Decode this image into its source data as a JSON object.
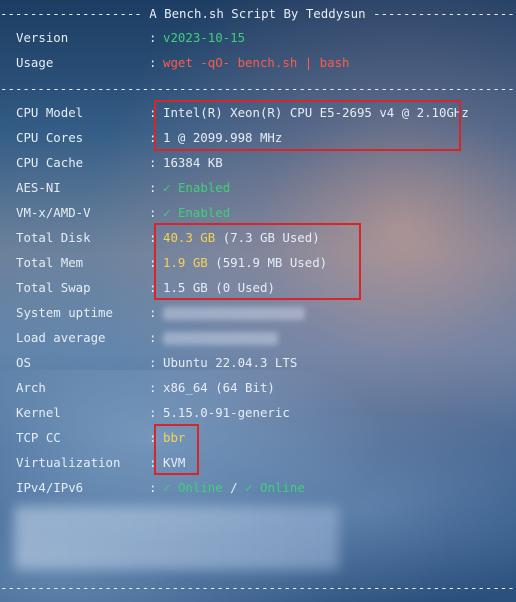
{
  "header_rule": "------------------- A Bench.sh Script By Teddysun -------------------",
  "footer_rule": "----------------------------------------------------------------------",
  "separator_rule": "----------------------------------------------------------------------",
  "colon": ":",
  "version": {
    "label": "Version",
    "value": "v2023-10-15"
  },
  "usage": {
    "label": "Usage",
    "value": "wget -qO- bench.sh | bash"
  },
  "cpu_model": {
    "label": "CPU Model",
    "value": "Intel(R) Xeon(R) CPU E5-2695 v4 @ 2.10GHz"
  },
  "cpu_cores": {
    "label": "CPU Cores",
    "value": "1 @ 2099.998 MHz"
  },
  "cpu_cache": {
    "label": "CPU Cache",
    "value": "16384 KB"
  },
  "aes_ni": {
    "label": "AES-NI",
    "check": "✓",
    "value": "Enabled"
  },
  "vmx": {
    "label": "VM-x/AMD-V",
    "check": "✓",
    "value": "Enabled"
  },
  "total_disk": {
    "label": "Total Disk",
    "value": "40.3 GB",
    "detail": "(7.3 GB Used)"
  },
  "total_mem": {
    "label": "Total Mem",
    "value": "1.9 GB",
    "detail": "(591.9 MB Used)"
  },
  "total_swap": {
    "label": "Total Swap",
    "value": "1.5 GB",
    "detail": "(0 Used)"
  },
  "uptime": {
    "label": "System uptime"
  },
  "load": {
    "label": "Load average"
  },
  "os": {
    "label": "OS",
    "value": "Ubuntu 22.04.3 LTS"
  },
  "arch": {
    "label": "Arch",
    "value": "x86_64 (64 Bit)"
  },
  "kernel": {
    "label": "Kernel",
    "value": "5.15.0-91-generic"
  },
  "tcp_cc": {
    "label": "TCP CC",
    "value": "bbr"
  },
  "virt": {
    "label": "Virtualization",
    "value": "KVM"
  },
  "ip": {
    "label": "IPv4/IPv6",
    "check": "✓",
    "v4": "Online",
    "slash": "/",
    "v6": "Online"
  },
  "colors": {
    "green": "#3fd07a",
    "red": "#ff5a4d",
    "yellow": "#f3d357",
    "highlight_box": "#d8252a"
  }
}
